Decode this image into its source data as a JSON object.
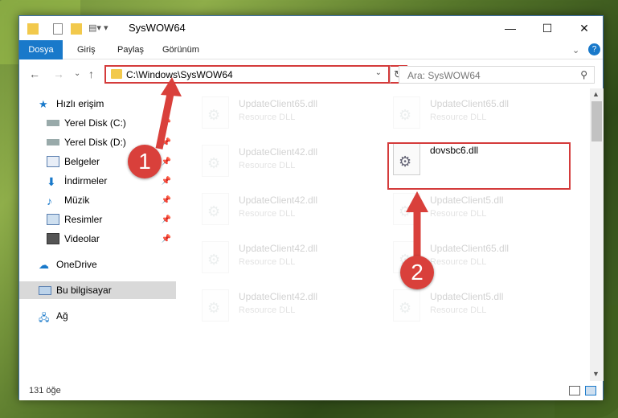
{
  "window": {
    "title": "SysWOW64",
    "controls": {
      "minimize": "—",
      "maximize": "☐",
      "close": "✕"
    }
  },
  "ribbon": {
    "tabs": [
      {
        "label": "Dosya",
        "active": true
      },
      {
        "label": "Giriş",
        "active": false
      },
      {
        "label": "Paylaş",
        "active": false
      },
      {
        "label": "Görünüm",
        "active": false
      }
    ]
  },
  "address": {
    "path": "C:\\Windows\\SysWOW64"
  },
  "search": {
    "placeholder": "Ara: SysWOW64"
  },
  "nav": {
    "items": [
      {
        "label": "Hızlı erişim",
        "icon": "star-icon",
        "pinned": false
      },
      {
        "label": "Yerel Disk (C:)",
        "icon": "disk-icon",
        "pinned": true
      },
      {
        "label": "Yerel Disk (D:)",
        "icon": "disk-icon",
        "pinned": true
      },
      {
        "label": "Belgeler",
        "icon": "documents-icon",
        "pinned": true
      },
      {
        "label": "İndirmeler",
        "icon": "download-icon",
        "pinned": true
      },
      {
        "label": "Müzik",
        "icon": "music-icon",
        "pinned": true
      },
      {
        "label": "Resimler",
        "icon": "pictures-icon",
        "pinned": true
      },
      {
        "label": "Videolar",
        "icon": "videos-icon",
        "pinned": true
      },
      {
        "label": "OneDrive",
        "icon": "cloud-icon",
        "pinned": false
      },
      {
        "label": "Bu bilgisayar",
        "icon": "computer-icon",
        "pinned": false
      },
      {
        "label": "Ağ",
        "icon": "network-icon",
        "pinned": false
      }
    ]
  },
  "files": {
    "left": [
      {
        "name": "UpdateClient65.dll",
        "type": "Resource DLL"
      },
      {
        "name": "UpdateClient42.dll",
        "type": "Resource DLL"
      },
      {
        "name": "UpdateClient42.dll",
        "type": "Resource DLL"
      },
      {
        "name": "UpdateClient42.dll",
        "type": "Resource DLL"
      },
      {
        "name": "UpdateClient42.dll",
        "type": "Resource DLL"
      }
    ],
    "right": [
      {
        "name": "UpdateClient65.dll",
        "type": "Resource DLL"
      },
      {
        "name": "dovsbc6.dll",
        "type": ""
      },
      {
        "name": "UpdateClient5.dll",
        "type": "Resource DLL"
      },
      {
        "name": "UpdateClient65.dll",
        "type": "Resource DLL"
      },
      {
        "name": "UpdateClient5.dll",
        "type": "Resource DLL"
      }
    ]
  },
  "status": {
    "count": "131 öğe"
  },
  "markers": {
    "one": "1",
    "two": "2"
  },
  "colors": {
    "accent": "#1979ca",
    "highlight": "#d43b3b",
    "marker": "#d9403b"
  }
}
